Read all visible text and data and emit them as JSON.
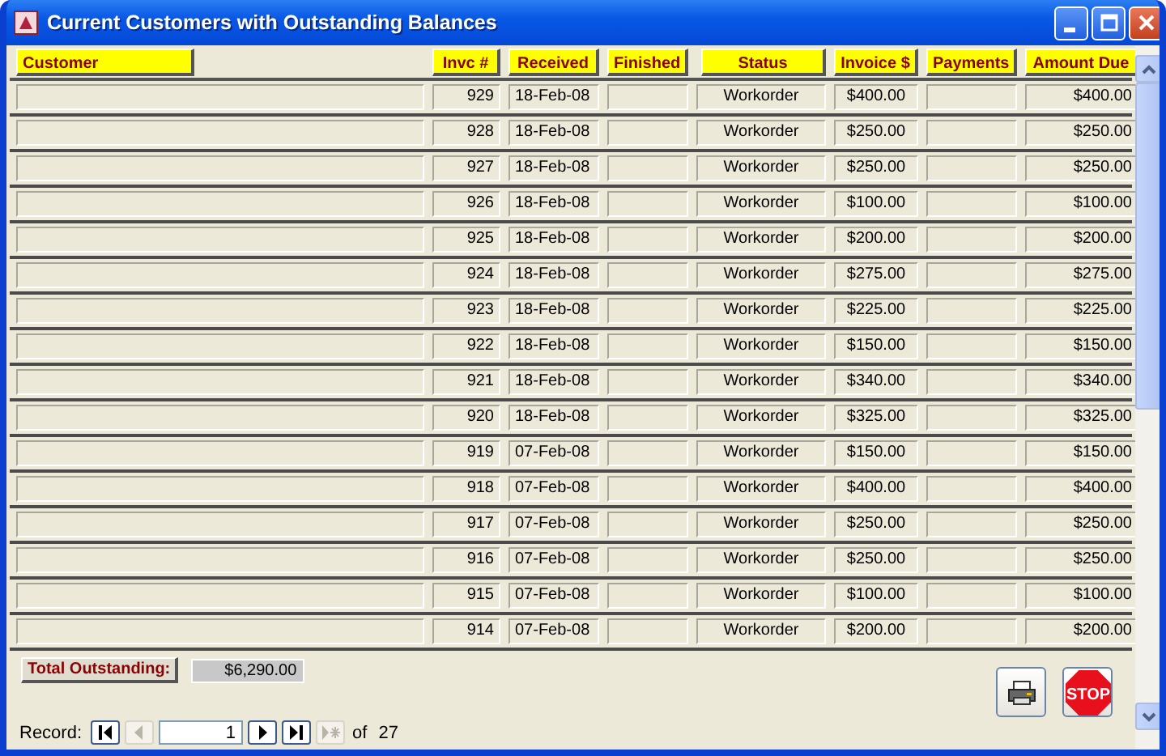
{
  "window": {
    "title": "Current Customers with Outstanding Balances"
  },
  "columns": [
    "Customer",
    "Invc #",
    "Received",
    "Finished",
    "Status",
    "Invoice $",
    "Payments",
    "Amount Due"
  ],
  "rows": [
    {
      "invc": "929",
      "received": "18-Feb-08",
      "status": "Workorder",
      "invoice": "$400.00",
      "amount_due": "$400.00"
    },
    {
      "invc": "928",
      "received": "18-Feb-08",
      "status": "Workorder",
      "invoice": "$250.00",
      "amount_due": "$250.00"
    },
    {
      "invc": "927",
      "received": "18-Feb-08",
      "status": "Workorder",
      "invoice": "$250.00",
      "amount_due": "$250.00"
    },
    {
      "invc": "926",
      "received": "18-Feb-08",
      "status": "Workorder",
      "invoice": "$100.00",
      "amount_due": "$100.00"
    },
    {
      "invc": "925",
      "received": "18-Feb-08",
      "status": "Workorder",
      "invoice": "$200.00",
      "amount_due": "$200.00"
    },
    {
      "invc": "924",
      "received": "18-Feb-08",
      "status": "Workorder",
      "invoice": "$275.00",
      "amount_due": "$275.00"
    },
    {
      "invc": "923",
      "received": "18-Feb-08",
      "status": "Workorder",
      "invoice": "$225.00",
      "amount_due": "$225.00"
    },
    {
      "invc": "922",
      "received": "18-Feb-08",
      "status": "Workorder",
      "invoice": "$150.00",
      "amount_due": "$150.00"
    },
    {
      "invc": "921",
      "received": "18-Feb-08",
      "status": "Workorder",
      "invoice": "$340.00",
      "amount_due": "$340.00"
    },
    {
      "invc": "920",
      "received": "18-Feb-08",
      "status": "Workorder",
      "invoice": "$325.00",
      "amount_due": "$325.00"
    },
    {
      "invc": "919",
      "received": "07-Feb-08",
      "status": "Workorder",
      "invoice": "$150.00",
      "amount_due": "$150.00"
    },
    {
      "invc": "918",
      "received": "07-Feb-08",
      "status": "Workorder",
      "invoice": "$400.00",
      "amount_due": "$400.00"
    },
    {
      "invc": "917",
      "received": "07-Feb-08",
      "status": "Workorder",
      "invoice": "$250.00",
      "amount_due": "$250.00"
    },
    {
      "invc": "916",
      "received": "07-Feb-08",
      "status": "Workorder",
      "invoice": "$250.00",
      "amount_due": "$250.00"
    },
    {
      "invc": "915",
      "received": "07-Feb-08",
      "status": "Workorder",
      "invoice": "$100.00",
      "amount_due": "$100.00"
    },
    {
      "invc": "914",
      "received": "07-Feb-08",
      "status": "Workorder",
      "invoice": "$200.00",
      "amount_due": "$200.00"
    }
  ],
  "total": {
    "label": "Total Outstanding:",
    "value": "$6,290.00"
  },
  "stop_button": {
    "label": "STOP"
  },
  "navigator": {
    "label": "Record:",
    "current": "1",
    "of_label": "of",
    "count": "27"
  }
}
